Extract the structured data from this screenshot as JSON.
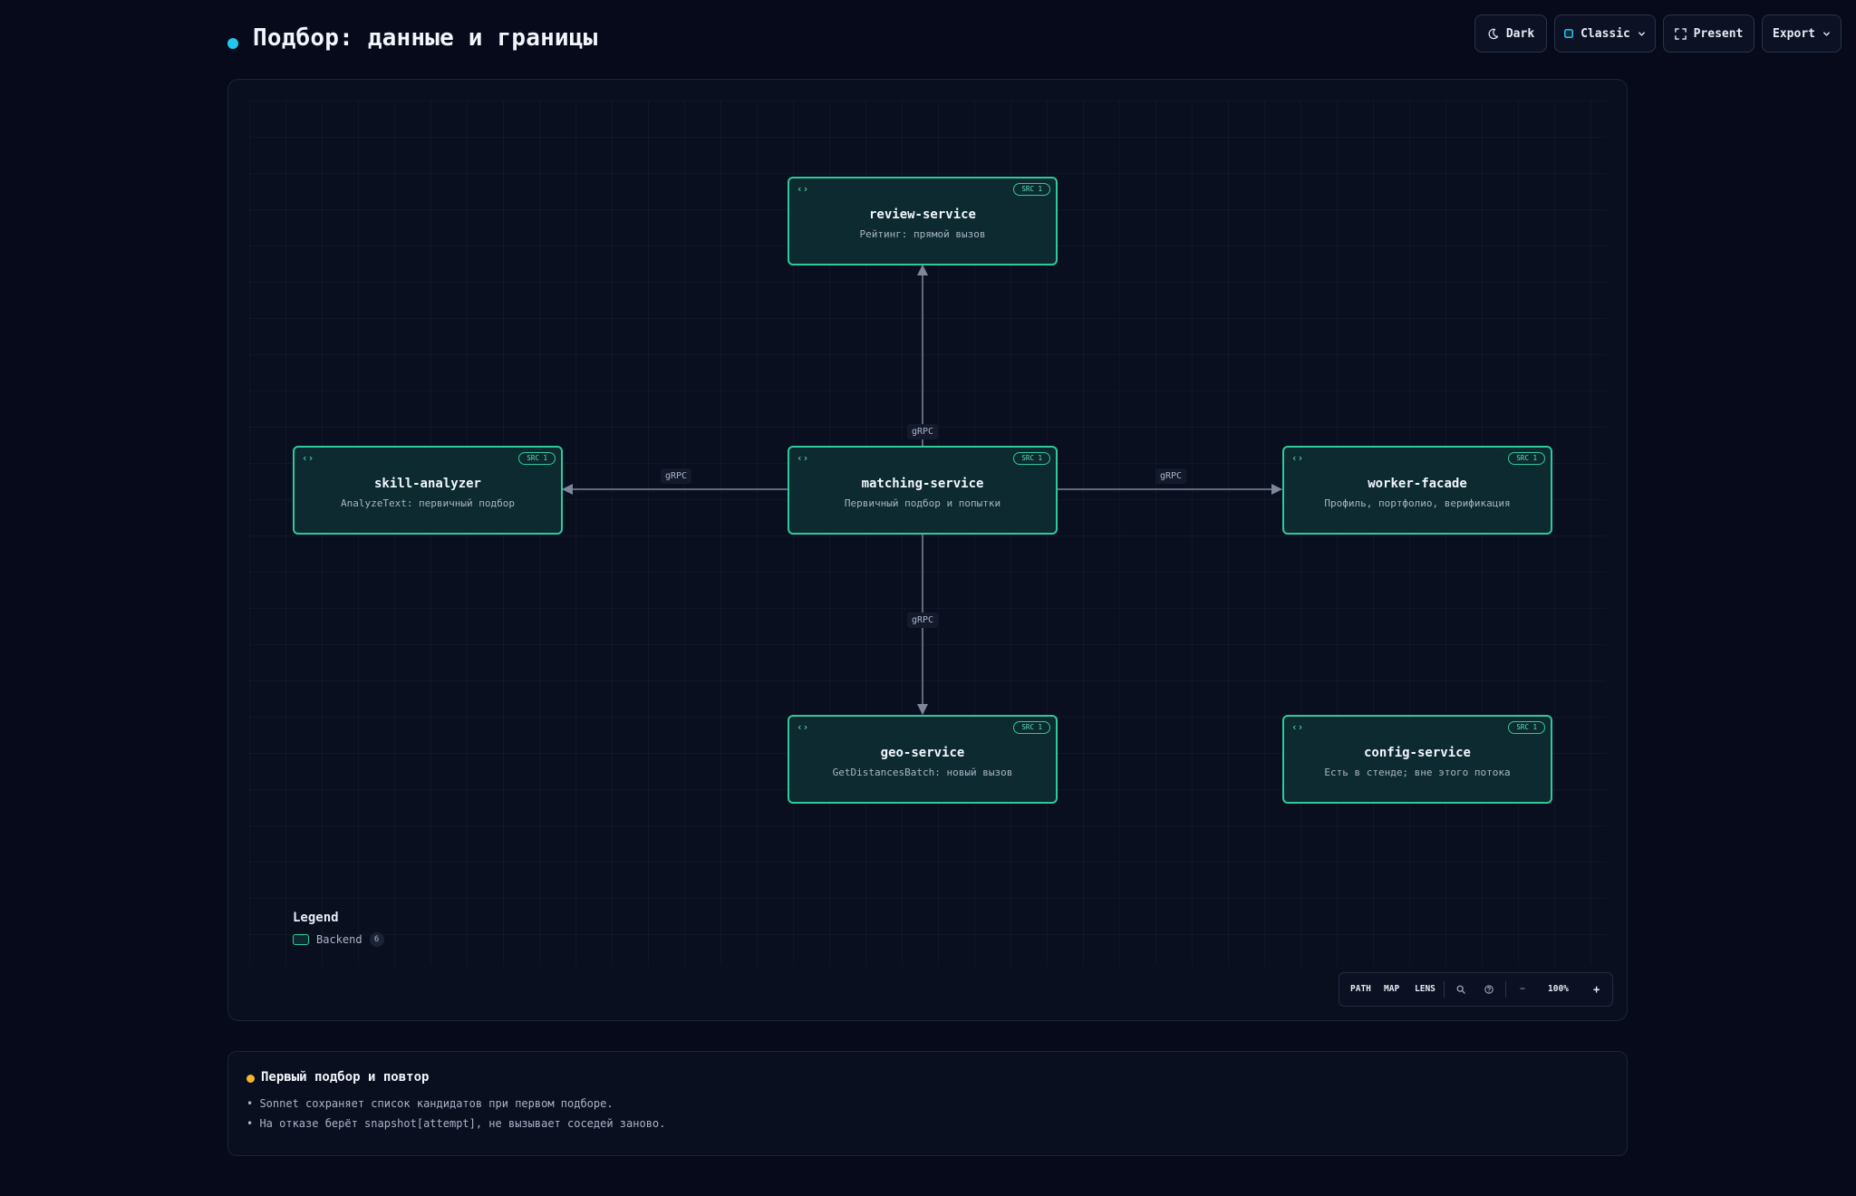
{
  "page": {
    "title": "Подбор: данные и границы",
    "accent_color": "#22c7ee"
  },
  "toolbar": {
    "theme_label": "Dark",
    "style_label": "Classic",
    "present_label": "Present",
    "export_label": "Export"
  },
  "diagram": {
    "node_color": "#2fc99a",
    "nodes": [
      {
        "id": "review",
        "title": "review-service",
        "subtitle": "Рейтинг: прямой вызов",
        "badge": "SRC 1",
        "icon": "code-icon"
      },
      {
        "id": "skill",
        "title": "skill-analyzer",
        "subtitle": "AnalyzeText: первичный подбор",
        "badge": "SRC 1",
        "icon": "code-icon"
      },
      {
        "id": "matching",
        "title": "matching-service",
        "subtitle": "Первичный подбор и попытки",
        "badge": "SRC 1",
        "icon": "code-icon"
      },
      {
        "id": "worker",
        "title": "worker-facade",
        "subtitle": "Профиль, портфолио, верификация",
        "badge": "SRC 1",
        "icon": "code-icon"
      },
      {
        "id": "geo",
        "title": "geo-service",
        "subtitle": "GetDistancesBatch: новый вызов",
        "badge": "SRC 1",
        "icon": "code-icon"
      },
      {
        "id": "config",
        "title": "config-service",
        "subtitle": "Есть в стенде; вне этого потока",
        "badge": "SRC 1",
        "icon": "code-icon"
      }
    ],
    "edges": [
      {
        "from": "matching",
        "to": "review",
        "label": "gRPC"
      },
      {
        "from": "matching",
        "to": "skill",
        "label": "gRPC"
      },
      {
        "from": "matching",
        "to": "worker",
        "label": "gRPC"
      },
      {
        "from": "matching",
        "to": "geo",
        "label": "gRPC"
      }
    ]
  },
  "legend": {
    "title": "Legend",
    "items": [
      {
        "label": "Backend",
        "count": "6"
      }
    ]
  },
  "controls": {
    "path_label": "PATH",
    "map_label": "MAP",
    "lens_label": "LENS",
    "zoom_level": "100%",
    "zoom_out_label": "−",
    "zoom_in_label": "+"
  },
  "notes": {
    "title": "Первый подбор и повтор",
    "accent_color": "#f5b52a",
    "lines": [
      "• Sonnet сохраняет список кандидатов при первом подборе.",
      "• На отказе берёт snapshot[attempt], не вызывает соседей заново."
    ]
  }
}
